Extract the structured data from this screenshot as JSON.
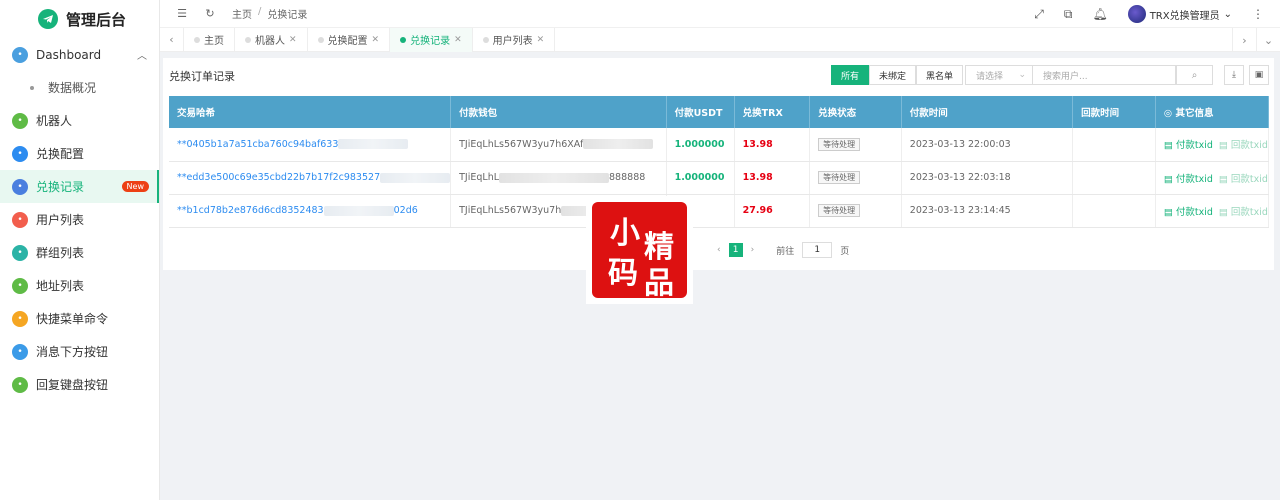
{
  "app": {
    "title": "管理后台"
  },
  "sidebar": {
    "items": [
      {
        "label": "Dashboard",
        "icon": "home-icon",
        "color": "#4a9fdf"
      },
      {
        "label": "数据概况",
        "sub": true
      },
      {
        "label": "机器人",
        "icon": "monitor-icon",
        "color": "#5fbb46"
      },
      {
        "label": "兑换配置",
        "icon": "at-icon",
        "color": "#2d8cf0"
      },
      {
        "label": "兑换记录",
        "icon": "document-icon",
        "color": "#4a7fdf",
        "active": true,
        "badge": "New"
      },
      {
        "label": "用户列表",
        "icon": "user-icon",
        "color": "#f25e4d"
      },
      {
        "label": "群组列表",
        "icon": "group-icon",
        "color": "#2bb3a6"
      },
      {
        "label": "地址列表",
        "icon": "cube-icon",
        "color": "#5fbb46"
      },
      {
        "label": "快捷菜单命令",
        "icon": "sliders-icon",
        "color": "#f5a623"
      },
      {
        "label": "消息下方按钮",
        "icon": "window-icon",
        "color": "#3b9be8"
      },
      {
        "label": "回复键盘按钮",
        "icon": "keyboard-icon",
        "color": "#5fbb46"
      }
    ]
  },
  "header": {
    "breadcrumb": [
      "主页",
      "兑换记录"
    ],
    "user_name": "TRX兑换管理员"
  },
  "tabs": [
    {
      "label": "主页",
      "closable": false
    },
    {
      "label": "机器人",
      "closable": true
    },
    {
      "label": "兑换配置",
      "closable": true
    },
    {
      "label": "兑换记录",
      "closable": true,
      "active": true
    },
    {
      "label": "用户列表",
      "closable": true
    }
  ],
  "card": {
    "title": "兑换订单记录",
    "filters": [
      "所有",
      "未绑定",
      "黑名单"
    ],
    "select_placeholder": "请选择",
    "search_placeholder": "搜索用户..."
  },
  "table": {
    "columns": [
      "交易哈希",
      "付款钱包",
      "付款USDT",
      "兑换TRX",
      "兑换状态",
      "付款时间",
      "回款时间",
      "◎ 其它信息"
    ],
    "rows": [
      {
        "hash": "**0405b1a7a51cba760c94baf633",
        "wallet": "TJiEqLhLs567W3yu7h6XAf",
        "usdt": "1.000000",
        "trx": "13.98",
        "status": "等待处理",
        "pay_time": "2023-03-13 22:00:03",
        "return_time": ""
      },
      {
        "hash": "**edd3e500c69e35cbd22b7b17f2c983527",
        "wallet": "TJiEqLhL",
        "wallet_tail": "888888",
        "usdt": "1.000000",
        "trx": "13.98",
        "status": "等待处理",
        "pay_time": "2023-03-13 22:03:18",
        "return_time": ""
      },
      {
        "hash": "**b1cd78b2e876d6cd8352483",
        "hash_tail": "02d6",
        "wallet": "TJiEqLhLs567W3yu7h",
        "usdt": "",
        "trx": "27.96",
        "status": "等待处理",
        "pay_time": "2023-03-13 23:14:45",
        "return_time": ""
      }
    ],
    "info_a": "付款txid",
    "info_b": "回款txid"
  },
  "pager": {
    "current": "1",
    "goto_label": "前往",
    "goto_value": "1",
    "page_suffix": "页"
  },
  "stamp": {
    "chars": [
      "小",
      "精",
      "码",
      "品"
    ]
  }
}
